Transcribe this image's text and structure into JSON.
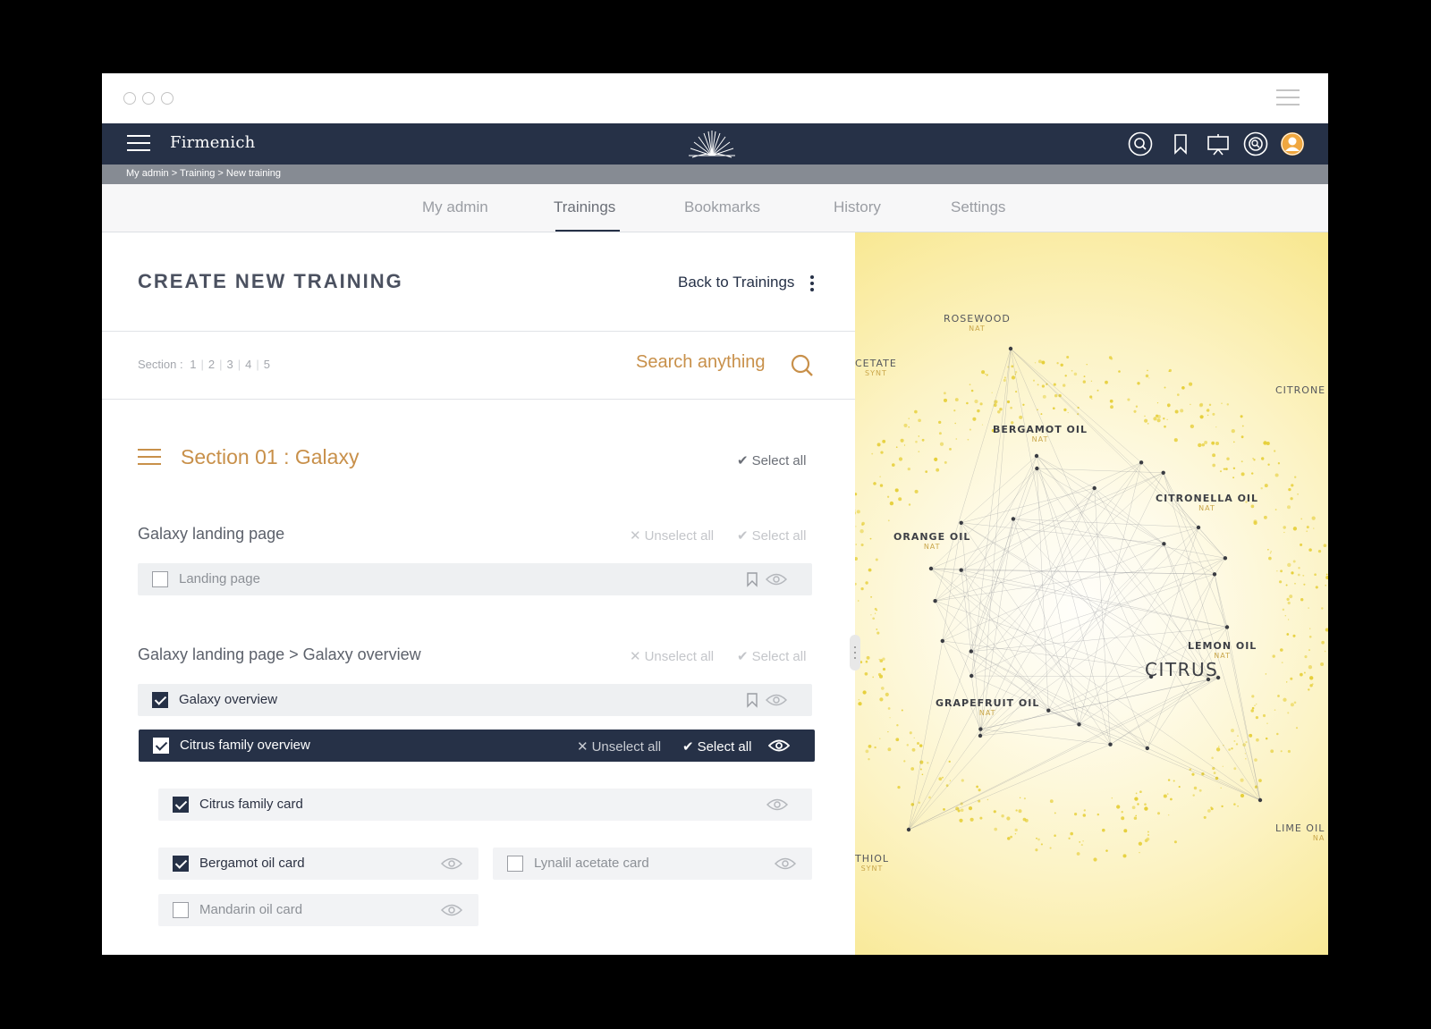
{
  "topbar": {
    "logo": "Firmenich"
  },
  "breadcrumb": "My admin > Training > New training",
  "tabs": [
    {
      "label": "My admin"
    },
    {
      "label": "Trainings"
    },
    {
      "label": "Bookmarks"
    },
    {
      "label": "History"
    },
    {
      "label": "Settings"
    }
  ],
  "active_tab": "Trainings",
  "page": {
    "title": "CREATE NEW TRAINING",
    "back_link": "Back to Trainings"
  },
  "section_nav": {
    "label": "Section :",
    "numbers": [
      "1",
      "2",
      "3",
      "4",
      "5"
    ]
  },
  "search": {
    "placeholder": "Search anything"
  },
  "section": {
    "prefix": "Section 01 :",
    "name": "Galaxy",
    "select_all": "Select all"
  },
  "actions": {
    "unselect_all": "Unselect all",
    "select_all": "Select all"
  },
  "groups": [
    {
      "title": "Galaxy landing page"
    },
    {
      "title": "Galaxy landing page > Galaxy overview"
    }
  ],
  "items": {
    "landing_page": {
      "label": "Landing page",
      "checked": false
    },
    "galaxy_overview": {
      "label": "Galaxy overview",
      "checked": true
    },
    "citrus_family_overview": {
      "label": "Citrus family overview",
      "checked": true
    },
    "citrus_family_card": {
      "label": "Citrus family card",
      "checked": true
    },
    "bergamot_oil_card": {
      "label": "Bergamot oil card",
      "checked": true
    },
    "lynalil_acetate_card": {
      "label": "Lynalil acetate card",
      "checked": false
    },
    "mandarin_oil_card": {
      "label": "Mandarin oil card",
      "checked": false
    }
  },
  "galaxy": {
    "center": "CITRUS",
    "labels": [
      {
        "name": "ROSEWOOD",
        "sub": "NAT"
      },
      {
        "name": "CETATE",
        "sub": "SYNT"
      },
      {
        "name": "CITRONE",
        "sub": ""
      },
      {
        "name": "BERGAMOT OIL",
        "sub": "NAT"
      },
      {
        "name": "CITRONELLA OIL",
        "sub": "NAT"
      },
      {
        "name": "ORANGE OIL",
        "sub": "NAT"
      },
      {
        "name": "LEMON OIL",
        "sub": "NAT"
      },
      {
        "name": "GRAPEFRUIT OIL",
        "sub": "NAT"
      },
      {
        "name": "LIME OIL",
        "sub": "NA"
      },
      {
        "name": "THIOL",
        "sub": "SYNT"
      }
    ]
  },
  "colors": {
    "navy": "#263147",
    "gold": "#c8904a",
    "breadcrumb_bg": "#868b93"
  },
  "icons": [
    "search-icon",
    "bookmark-icon",
    "presentation-icon",
    "target-icon",
    "user-avatar-icon",
    "eye-icon",
    "check-icon",
    "close-icon",
    "menu-icon",
    "kebab-icon"
  ]
}
